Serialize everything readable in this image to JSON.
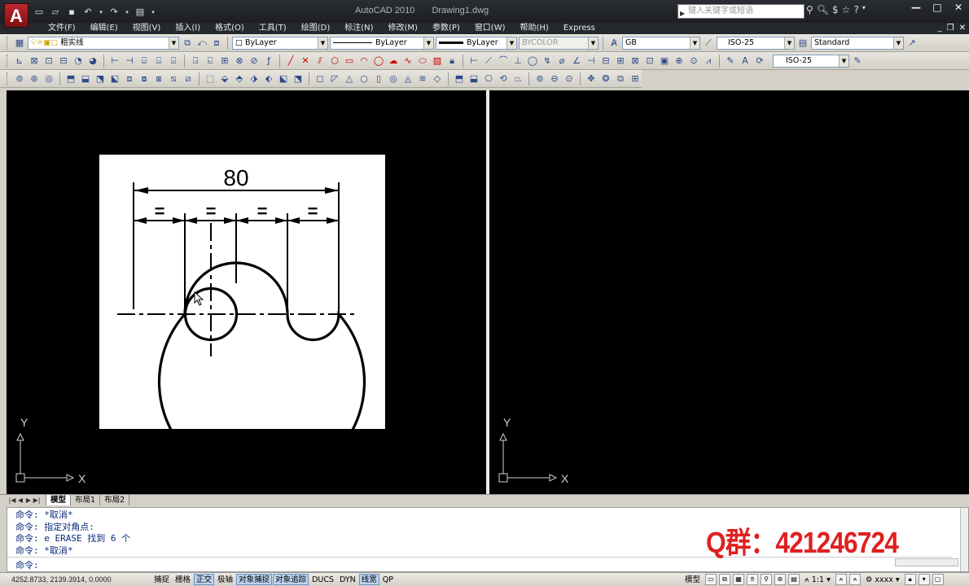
{
  "titlebar": {
    "app_name": "AutoCAD 2010",
    "document": "Drawing1.dwg",
    "search_placeholder": "键入关键字或短语",
    "minimize": "—",
    "restore": "□",
    "close": "✕"
  },
  "menu": {
    "items": [
      "文件(F)",
      "编辑(E)",
      "视图(V)",
      "插入(I)",
      "格式(O)",
      "工具(T)",
      "绘图(D)",
      "标注(N)",
      "修改(M)",
      "参数(P)",
      "窗口(W)",
      "帮助(H)",
      "Express"
    ]
  },
  "toolbar1": {
    "layer": "粗实线",
    "color": "ByLayer",
    "linetype": "ByLayer",
    "lineweight": "ByLayer",
    "plotstyle": "BYCOLOR",
    "textstyle": "GB",
    "dimstyle": "ISO-25",
    "tablestyle": "Standard"
  },
  "toolbar2": {
    "multileader_style": "ISO-25"
  },
  "drawing": {
    "dimension_total": "80",
    "dimension_equal": "=",
    "ucs_x": "X",
    "ucs_y": "Y"
  },
  "tabs": {
    "items": [
      "模型",
      "布局1",
      "布局2"
    ],
    "active": "模型"
  },
  "command": {
    "history": [
      "命令: *取消*",
      "命令: 指定对角点:",
      "命令: e ERASE 找到 6 个",
      "命令: *取消*"
    ],
    "prompt": "命令:"
  },
  "watermark": {
    "text": "Q群：421246724"
  },
  "statusbar": {
    "coords": "4252.8733,  2139.3914,  0.0000",
    "toggles": [
      {
        "label": "捕捉",
        "on": false
      },
      {
        "label": "栅格",
        "on": false
      },
      {
        "label": "正交",
        "on": true
      },
      {
        "label": "极轴",
        "on": false
      },
      {
        "label": "对象捕捉",
        "on": true
      },
      {
        "label": "对象追踪",
        "on": true
      },
      {
        "label": "DUCS",
        "on": false
      },
      {
        "label": "DYN",
        "on": false
      },
      {
        "label": "线宽",
        "on": true
      },
      {
        "label": "QP",
        "on": false
      }
    ],
    "model_label": "模型",
    "annotation_scale": "1:1",
    "workspace": "xxxx"
  },
  "colors": {
    "titlebar": "#1c1e22",
    "viewport_bg": "#000000",
    "command_text": "#0a2a78",
    "watermark": "#e02020",
    "toggle_on": "#bcd3ef"
  }
}
